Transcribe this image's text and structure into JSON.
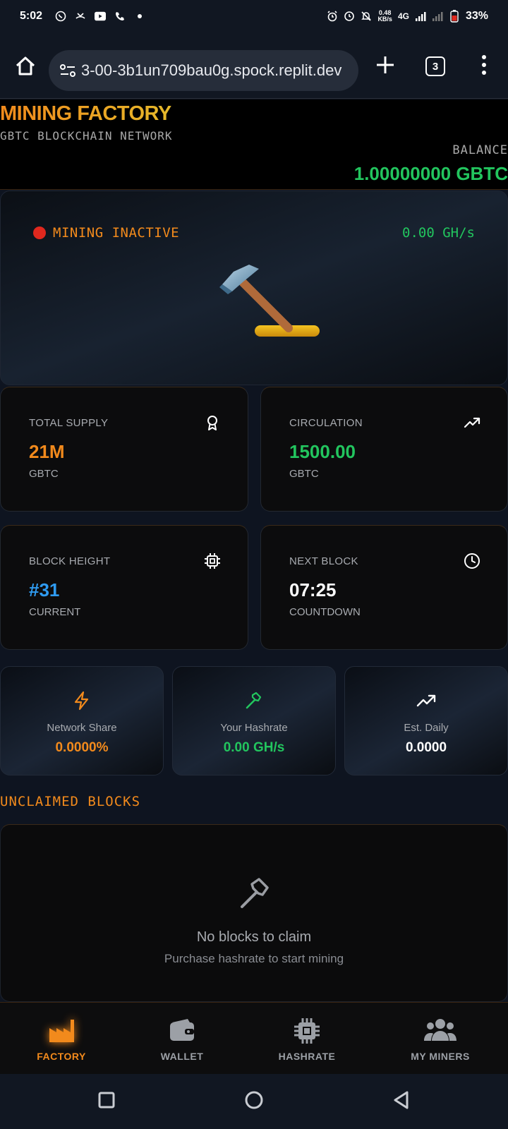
{
  "status_bar": {
    "time": "5:02",
    "net_speed_value": "0.48",
    "net_speed_unit": "KB/s",
    "network": "4G",
    "battery": "33%"
  },
  "browser": {
    "url": "3-00-3b1un709bau0g.spock.replit.dev",
    "tab_count": "3"
  },
  "header": {
    "title": "MINING FACTORY",
    "subtitle": "GBTC BLOCKCHAIN NETWORK",
    "balance_label": "BALANCE",
    "balance_value": "1.00000000 GBTC"
  },
  "hero": {
    "status": "MINING INACTIVE",
    "hashrate": "0.00 GH/s",
    "hammer_emoji": "🔨"
  },
  "stats": [
    {
      "label": "TOTAL SUPPLY",
      "value": "21M",
      "unit": "GBTC",
      "icon": "award-icon",
      "color": "#f28a1c"
    },
    {
      "label": "CIRCULATION",
      "value": "1500.00",
      "unit": "GBTC",
      "icon": "trending-up-icon",
      "color": "#22c55e"
    },
    {
      "label": "BLOCK HEIGHT",
      "value": "#31",
      "unit": "CURRENT",
      "icon": "cpu-icon",
      "color": "#2f9bf0"
    },
    {
      "label": "NEXT BLOCK",
      "value": "07:25",
      "unit": "COUNTDOWN",
      "icon": "clock-icon",
      "color": "#ffffff"
    }
  ],
  "mini": [
    {
      "label": "Network Share",
      "value": "0.0000%",
      "icon": "lightning-icon",
      "color": "#f28a1c"
    },
    {
      "label": "Your Hashrate",
      "value": "0.00 GH/s",
      "icon": "hammer-icon",
      "color": "#22c55e"
    },
    {
      "label": "Est. Daily",
      "value": "0.0000",
      "icon": "trending-up-icon",
      "color": "#ffffff"
    }
  ],
  "unclaimed": {
    "title": "UNCLAIMED BLOCKS",
    "empty_title": "No blocks to claim",
    "empty_sub": "Purchase hashrate to start mining"
  },
  "nav": [
    {
      "label": "FACTORY",
      "icon": "factory-icon",
      "active": true
    },
    {
      "label": "WALLET",
      "icon": "wallet-icon",
      "active": false
    },
    {
      "label": "HASHRATE",
      "icon": "chip-icon",
      "active": false
    },
    {
      "label": "MY MINERS",
      "icon": "users-icon",
      "active": false
    }
  ],
  "colors": {
    "accent": "#f28a1c",
    "positive": "#22c55e",
    "info": "#2f9bf0",
    "inactive_dot": "#e0281e"
  }
}
